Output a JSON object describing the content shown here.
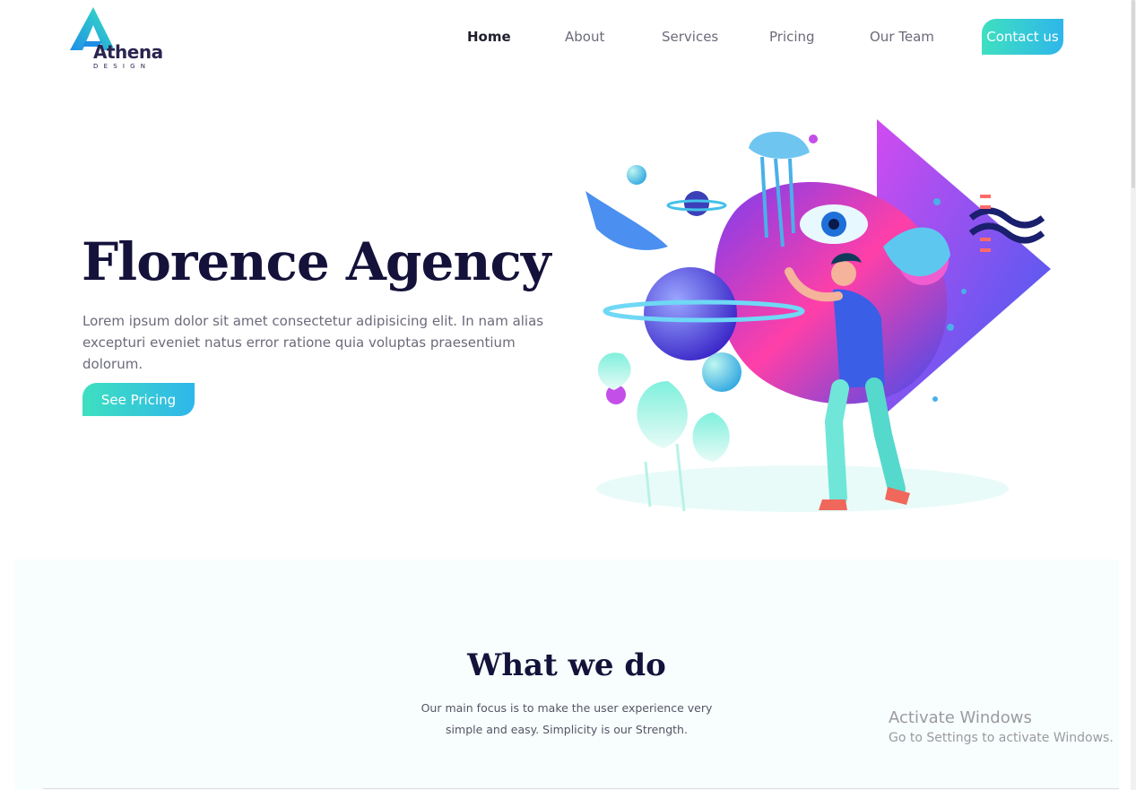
{
  "brand": {
    "name": "Athena",
    "tagline": "DESIGN"
  },
  "nav": {
    "items": [
      {
        "label": "Home",
        "active": true
      },
      {
        "label": "About",
        "active": false
      },
      {
        "label": "Services",
        "active": false
      },
      {
        "label": "Pricing",
        "active": false
      },
      {
        "label": "Our Team",
        "active": false
      }
    ],
    "contact_label": "Contact us"
  },
  "hero": {
    "title": "Florence Agency",
    "text": "Lorem ipsum dolor sit amet consectetur adipisicing elit. In nam alias excepturi eveniet natus error ratione quia voluptas praesentium dolorum.",
    "button_label": "See Pricing",
    "illustration_icon": "person-with-space-collage-illustration"
  },
  "what_we_do": {
    "title": "What we do",
    "text_line1": "Our main focus is to make the user experience very",
    "text_line2": "simple and easy. Simplicity is our Strength."
  },
  "watermark": {
    "title": "Activate Windows",
    "subtitle": "Go to Settings to activate Windows."
  },
  "colors": {
    "accent_start": "#3ee0c0",
    "accent_end": "#2eb6ea",
    "heading": "#14123a",
    "body_text": "#6b6b7b"
  }
}
